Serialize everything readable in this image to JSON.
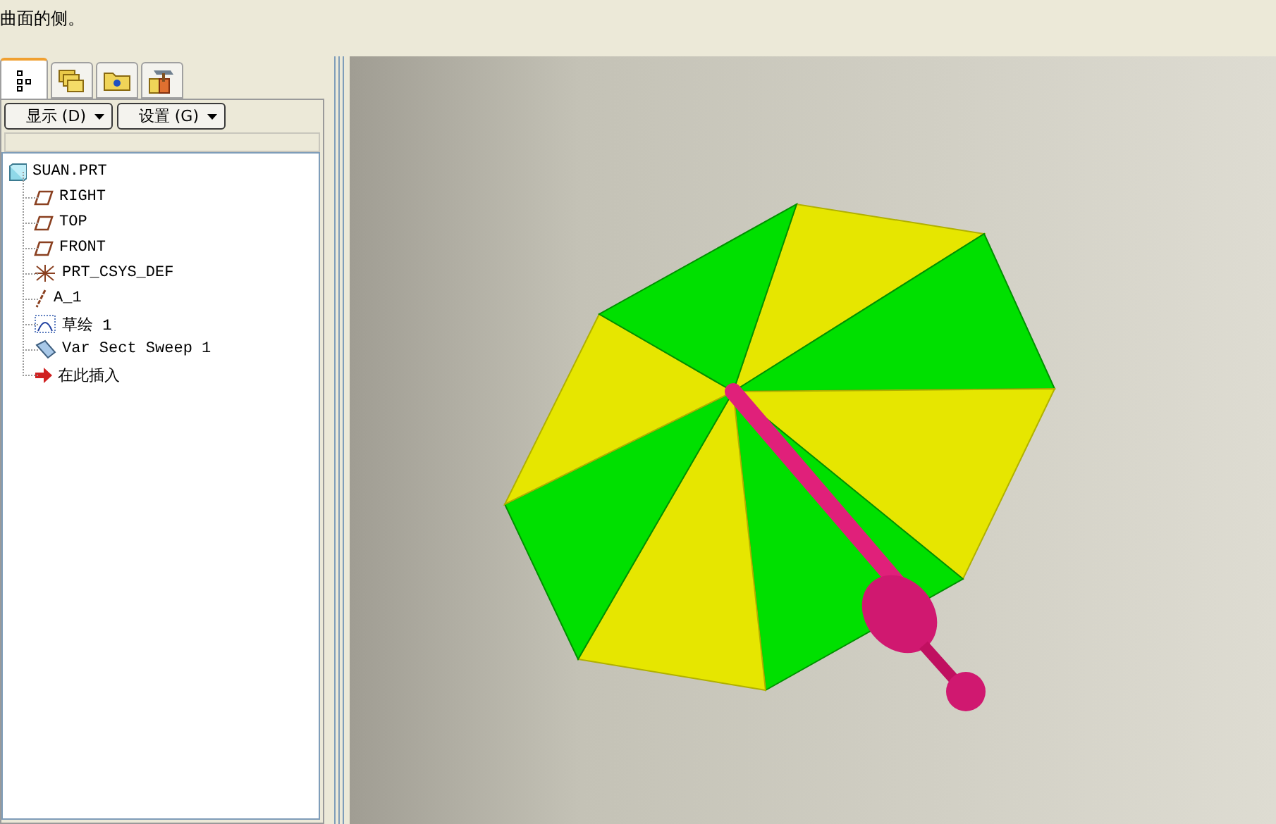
{
  "message": {
    "text": "曲面的侧。"
  },
  "panel_tabs": [
    {
      "kind": "tree",
      "selected": true
    },
    {
      "kind": "layers",
      "selected": false
    },
    {
      "kind": "folder",
      "selected": false
    },
    {
      "kind": "tools",
      "selected": false
    }
  ],
  "menu_buttons": [
    {
      "label": "显示 (D)"
    },
    {
      "label": "设置 (G)"
    }
  ],
  "model_tree": {
    "label": "SUAN.PRT",
    "kind": "part",
    "children": [
      {
        "label": "RIGHT",
        "kind": "plane"
      },
      {
        "label": "TOP",
        "kind": "plane"
      },
      {
        "label": "FRONT",
        "kind": "plane"
      },
      {
        "label": "PRT_CSYS_DEF",
        "kind": "csys"
      },
      {
        "label": "A_1",
        "kind": "axis"
      },
      {
        "label": "草绘 1",
        "kind": "sketch"
      },
      {
        "label": "Var Sect Sweep 1",
        "kind": "sweep"
      },
      {
        "label": "在此插入",
        "kind": "insert"
      }
    ]
  }
}
